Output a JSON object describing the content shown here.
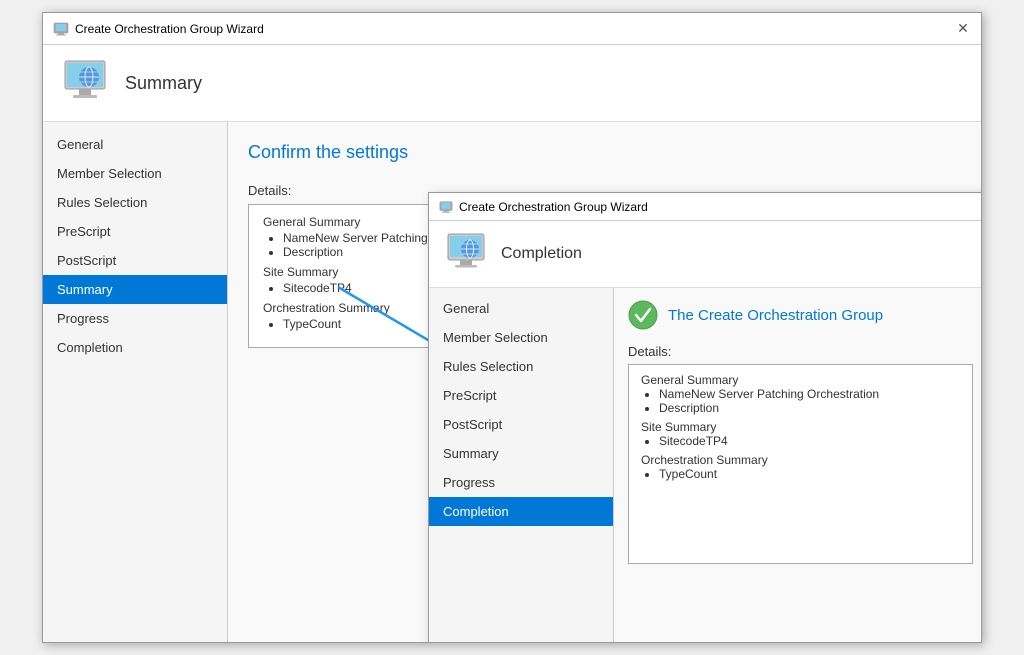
{
  "window": {
    "title": "Create Orchestration Group Wizard",
    "close_btn": "✕"
  },
  "header": {
    "title": "Summary"
  },
  "sidebar": {
    "items": [
      {
        "label": "General",
        "active": false
      },
      {
        "label": "Member Selection",
        "active": false
      },
      {
        "label": "Rules Selection",
        "active": false
      },
      {
        "label": "PreScript",
        "active": false
      },
      {
        "label": "PostScript",
        "active": false
      },
      {
        "label": "Summary",
        "active": true
      },
      {
        "label": "Progress",
        "active": false
      },
      {
        "label": "Completion",
        "active": false
      }
    ]
  },
  "main": {
    "confirm_title": "Confirm the settings",
    "details_label": "Details:",
    "general_summary_title": "General Summary",
    "general_summary_items": [
      "NameNew Server Patching Orchestration",
      "Description"
    ],
    "site_summary_title": "Site Summary",
    "site_summary_items": [
      "SitecodeTP4"
    ],
    "orchestration_summary_title": "Orchestration Summary",
    "orchestration_summary_items": [
      "TypeCount"
    ]
  },
  "overlay_window": {
    "title": "Create Orchestration Group Wizard",
    "header_title": "Completion",
    "sidebar_items": [
      {
        "label": "General",
        "active": false
      },
      {
        "label": "Member Selection",
        "active": false
      },
      {
        "label": "Rules Selection",
        "active": false
      },
      {
        "label": "PreScript",
        "active": false
      },
      {
        "label": "PostScript",
        "active": false
      },
      {
        "label": "Summary",
        "active": false
      },
      {
        "label": "Progress",
        "active": false
      },
      {
        "label": "Completion",
        "active": true
      }
    ],
    "success_title": "The Create Orchestration Group",
    "details_label": "Details:",
    "general_summary_title": "General Summary",
    "general_summary_items": [
      "NameNew Server Patching Orchestration",
      "Description"
    ],
    "site_summary_title": "Site Summary",
    "site_summary_items": [
      "SitecodeTP4"
    ],
    "orchestration_summary_title": "Orchestration Summary",
    "orchestration_summary_items": [
      "TypeCount"
    ]
  }
}
